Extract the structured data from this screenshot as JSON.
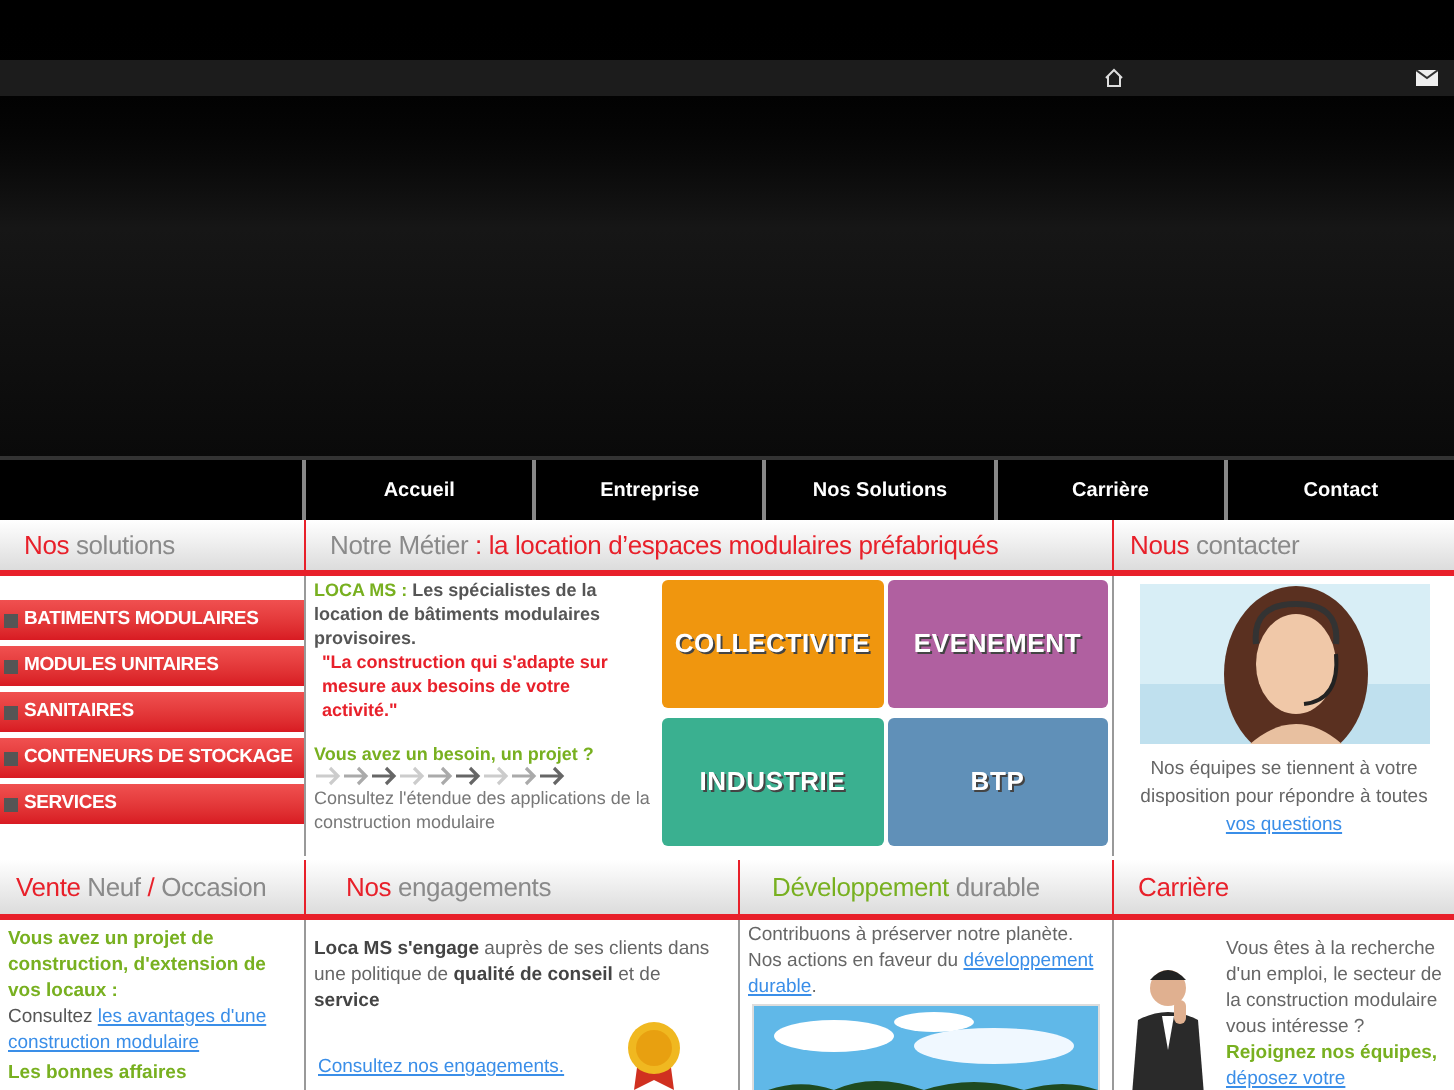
{
  "nav": [
    {
      "label": "Accueil",
      "selected": false
    },
    {
      "label": "Entreprise",
      "selected": false
    },
    {
      "label": "Nos Solutions",
      "selected": false
    },
    {
      "label": "Carrière",
      "selected": false
    },
    {
      "label": "Contact",
      "selected": false
    }
  ],
  "headings_top": [
    [
      {
        "text": "Nos",
        "color": "#e8202a"
      },
      {
        "text": " solutions",
        "color": "#8a8a8a"
      }
    ],
    [
      {
        "text": "Notre Métier",
        "color": "#8a8a8a"
      },
      {
        "text": " : la location d’espaces modulaires préfabriqués",
        "color": "#e8202a"
      }
    ],
    [
      {
        "text": "Nous",
        "color": "#e8202a"
      },
      {
        "text": " contacter",
        "color": "#8a8a8a"
      }
    ]
  ],
  "solutions": [
    "BATIMENTS MODULAIRES",
    "MODULES UNITAIRES",
    "SANITAIRES",
    "CONTENEURS DE STOCKAGE",
    "SERVICES"
  ],
  "metier": {
    "intro": "**LOCA MS :**  Les spécialistes de la location de bâtiments modulaires provisoires.",
    "quote": "\"La construction qui s'adapte sur mesure aux besoins de votre activité.\"",
    "question": "Vous avez un besoin, un projet ?",
    "text": "Consultez l'étendue des applications de la construction modulaire"
  },
  "tiles": [
    {
      "label": "COLLECTIVITE",
      "color": "#f0960e"
    },
    {
      "label": "EVENEMENT",
      "color": "#b060a0"
    },
    {
      "label": "INDUSTRIE",
      "color": "#3ab090"
    },
    {
      "label": "BTP",
      "color": "#6090b8"
    }
  ],
  "contact": {
    "text": "Nos équipes se tiennent à votre disposition pour répondre à toutes",
    "link": "vos questions"
  },
  "headings_bottom": [
    [
      {
        "text": "Vente",
        "color": "#e8202a"
      },
      {
        "text": " Neuf",
        "color": "#8a8a8a"
      },
      {
        "text": " / ",
        "color": "#e8202a"
      },
      {
        "text": "Occasion",
        "color": "#8a8a8a"
      }
    ],
    [
      {
        "text": "Nos",
        "color": "#e8202a"
      },
      {
        "text": " engagements",
        "color": "#8a8a8a"
      }
    ],
    [
      {
        "text": "Développement",
        "color": "#78b020"
      },
      {
        "text": " durable",
        "color": "#8a8a8a"
      }
    ],
    [
      {
        "text": "Carrière",
        "color": "#e8202a"
      }
    ]
  ],
  "vente": {
    "question": "Vous avez un projet de construction, d'extension de vos locaux :",
    "lead": "Consultez",
    "link": "les avantages d'une construction modulaire",
    "next": "Les bonnes affaires"
  },
  "engagements": {
    "text": "**Loca MS s'engage** auprès de ses clients dans une politique de **qualité de conseil** et de **service**",
    "link": "Consultez nos engagements."
  },
  "durable": {
    "text": "Contribuons à préserver notre planète. Nos actions en faveur du",
    "link": "développement durable",
    "end": "."
  },
  "carriere": {
    "text": "Vous êtes à la recherche d'un emploi, le secteur de la construction modulaire vous intéresse ?",
    "bold": "Rejoignez nos équipes,",
    "link": "déposez votre"
  }
}
